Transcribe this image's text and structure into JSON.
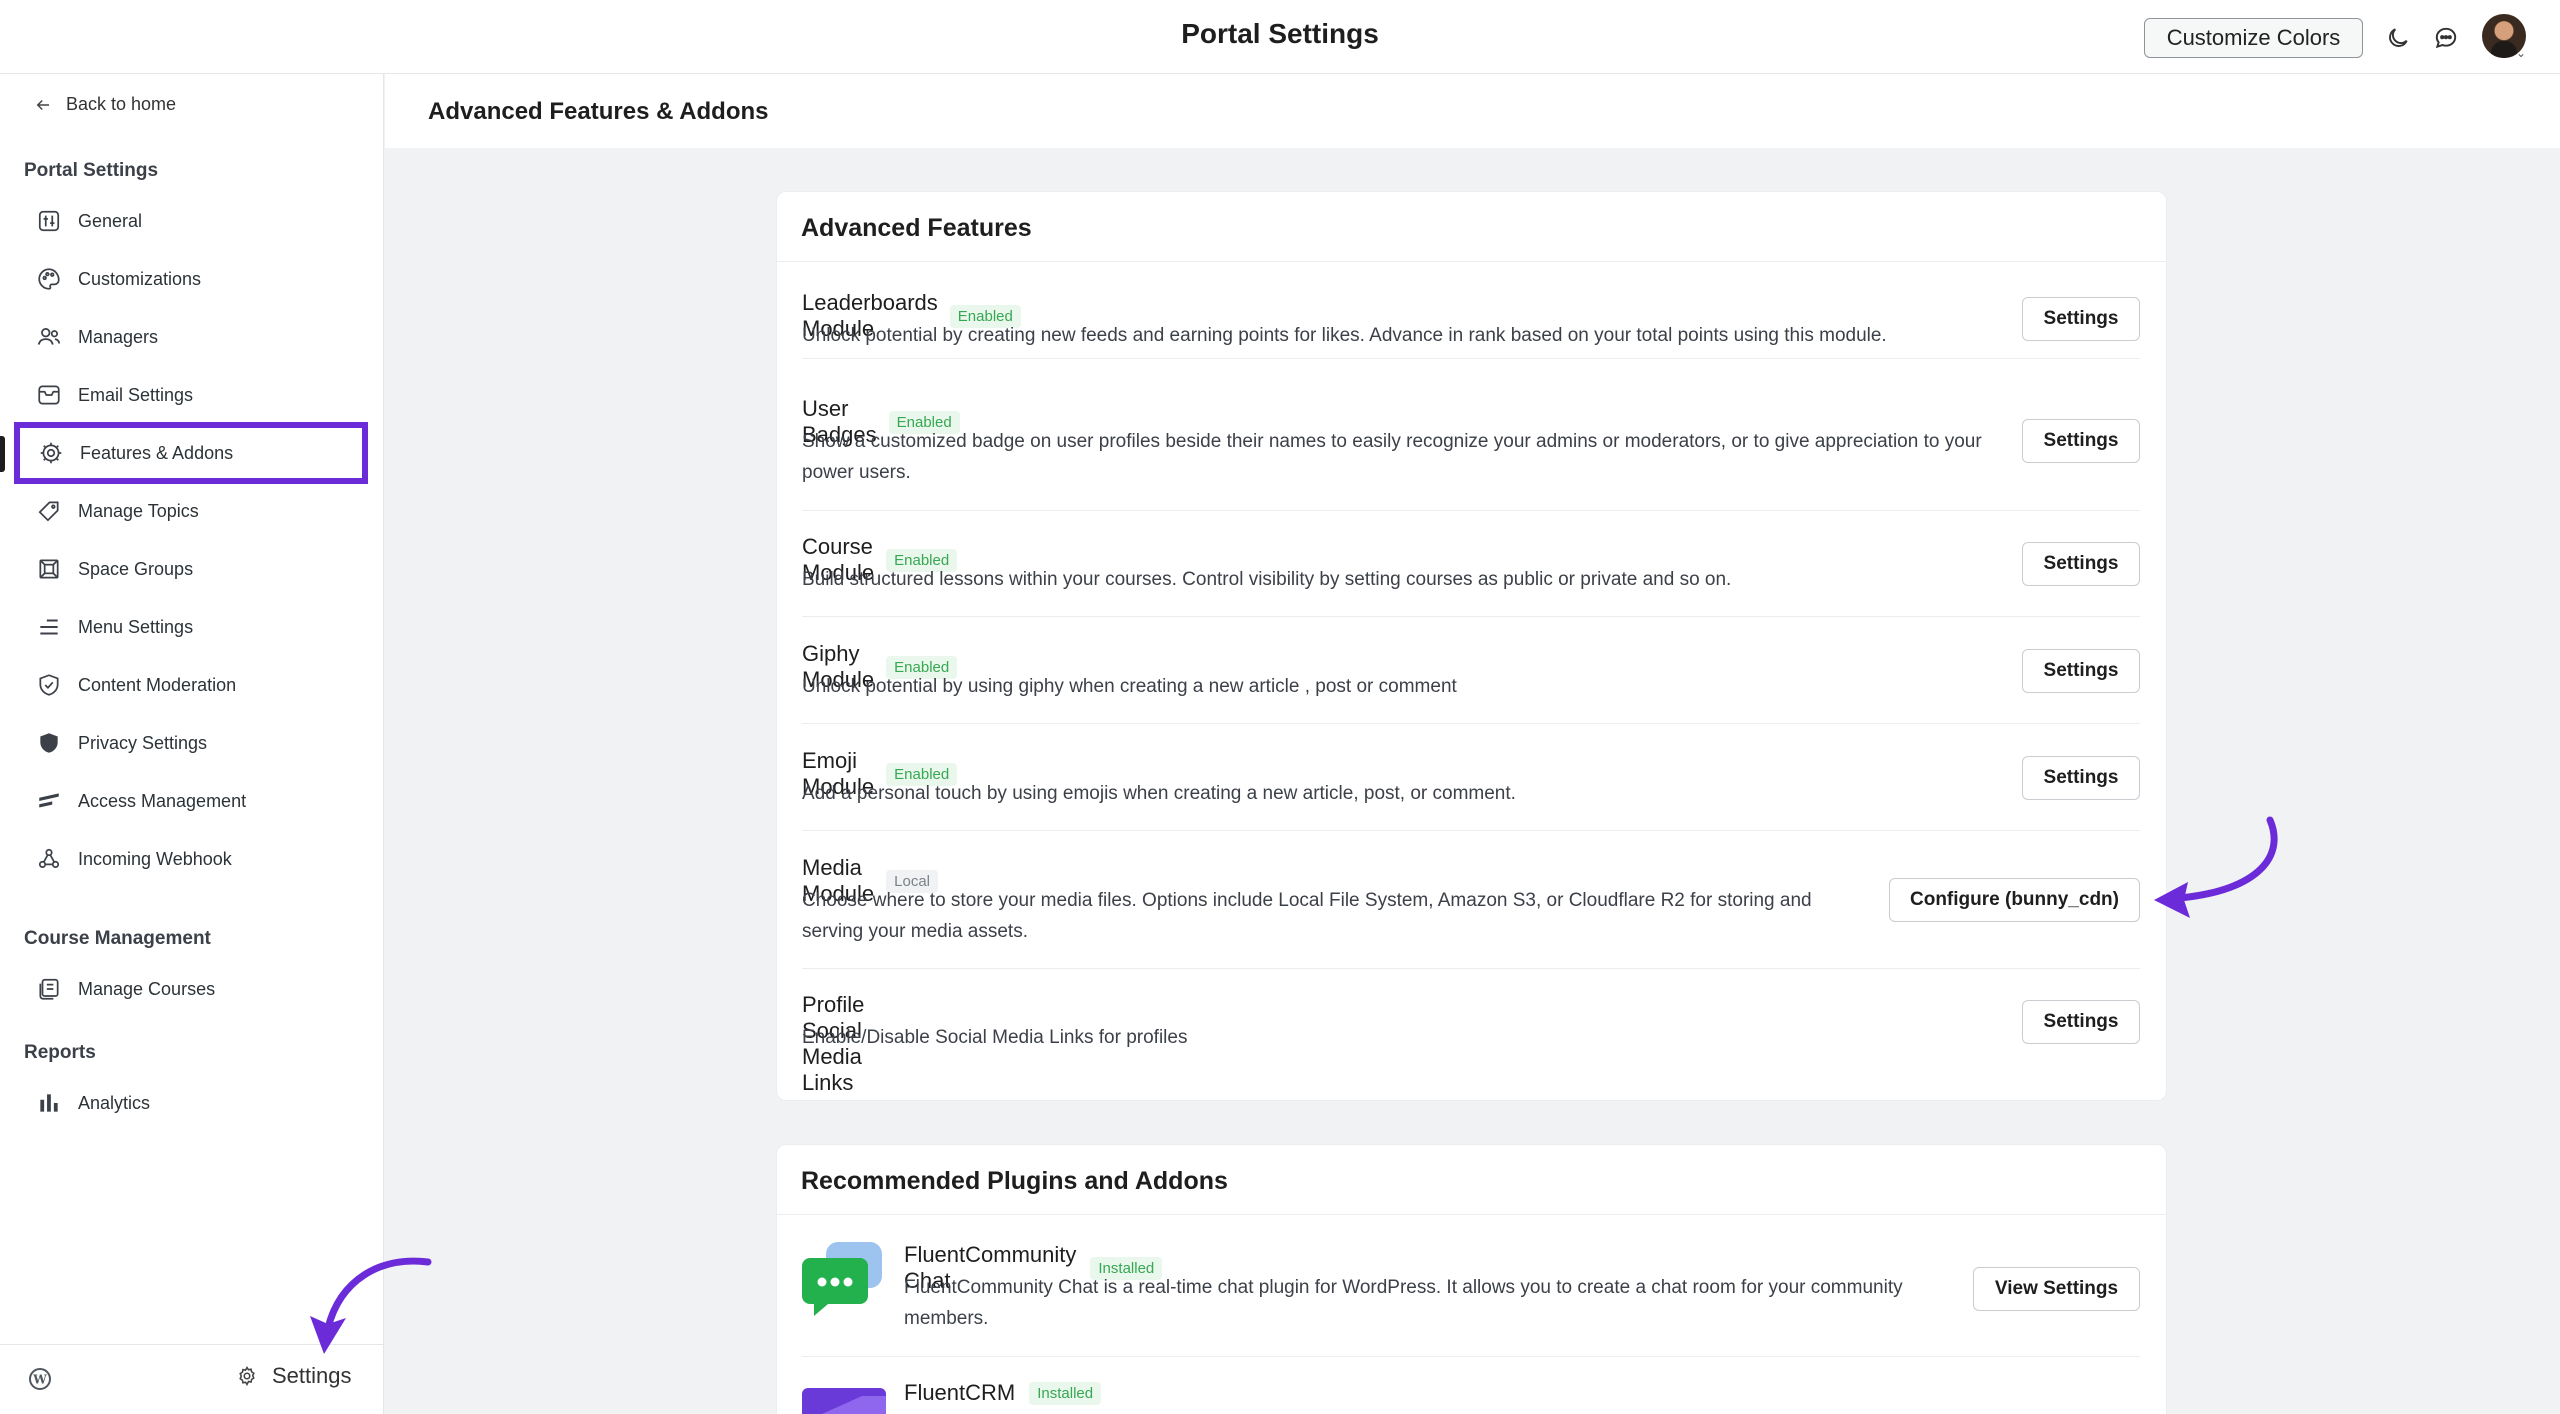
{
  "header": {
    "title": "Portal Settings",
    "customize_label": "Customize Colors"
  },
  "sidebar": {
    "back_label": "Back to home",
    "sections": [
      {
        "heading": "Portal Settings",
        "items": [
          {
            "label": "General",
            "icon": "general-icon"
          },
          {
            "label": "Customizations",
            "icon": "palette-icon"
          },
          {
            "label": "Managers",
            "icon": "users-icon"
          },
          {
            "label": "Email Settings",
            "icon": "mail-icon"
          },
          {
            "label": "Features & Addons",
            "icon": "cog-chip-icon",
            "active": true
          },
          {
            "label": "Manage Topics",
            "icon": "tag-icon"
          },
          {
            "label": "Space Groups",
            "icon": "space-groups-icon"
          },
          {
            "label": "Menu Settings",
            "icon": "menu-icon"
          },
          {
            "label": "Content Moderation",
            "icon": "shield-check-icon"
          },
          {
            "label": "Privacy Settings",
            "icon": "shield-icon"
          },
          {
            "label": "Access Management",
            "icon": "access-icon"
          },
          {
            "label": "Incoming Webhook",
            "icon": "webhook-icon"
          }
        ]
      },
      {
        "heading": "Course Management",
        "items": [
          {
            "label": "Manage Courses",
            "icon": "courses-icon"
          }
        ]
      },
      {
        "heading": "Reports",
        "items": [
          {
            "label": "Analytics",
            "icon": "bar-chart-icon"
          }
        ]
      }
    ],
    "footer_settings_label": "Settings"
  },
  "content": {
    "page_title": "Advanced Features & Addons",
    "features_card_title": "Advanced Features",
    "features": [
      {
        "name": "Leaderboards Module",
        "badge": "Enabled",
        "desc": "Unlock potential by creating new feeds and earning points for likes. Advance in rank based on your total points using this module.",
        "button": "Settings"
      },
      {
        "name": "User Badges",
        "badge": "Enabled",
        "desc": "Show a customized badge on user profiles beside their names to easily recognize your admins or moderators, or to give appreciation to your power users.",
        "button": "Settings"
      },
      {
        "name": "Course Module",
        "badge": "Enabled",
        "desc": "Build structured lessons within your courses. Control visibility by setting courses as public or private and so on.",
        "button": "Settings"
      },
      {
        "name": "Giphy Module",
        "badge": "Enabled",
        "desc": "Unlock potential by using giphy when creating a new article , post or comment",
        "button": "Settings"
      },
      {
        "name": "Emoji Module",
        "badge": "Enabled",
        "desc": "Add a personal touch by using emojis when creating a new article, post, or comment.",
        "button": "Settings"
      },
      {
        "name": "Media Module",
        "badge": "Local",
        "desc": "Choose where to store your media files. Options include Local File System, Amazon S3, or Cloudflare R2 for storing and serving your media assets.",
        "button": "Configure (bunny_cdn)"
      },
      {
        "name": "Profile Social Media Links",
        "badge": "",
        "desc": "Enable/Disable Social Media Links for profiles",
        "button": "Settings"
      }
    ],
    "plugins_card_title": "Recommended Plugins and Addons",
    "plugins": [
      {
        "name": "FluentCommunity Chat",
        "badge": "Installed",
        "desc": "FluentCommunity Chat is a real-time chat plugin for WordPress. It allows you to create a chat room for your community members.",
        "button": "View Settings"
      },
      {
        "name": "FluentCRM",
        "badge": "Installed",
        "desc": "",
        "button": ""
      }
    ]
  },
  "colors": {
    "accent": "#6b2bd9",
    "enabled_badge_bg": "#eaf7ec",
    "enabled_badge_text": "#36a852"
  }
}
